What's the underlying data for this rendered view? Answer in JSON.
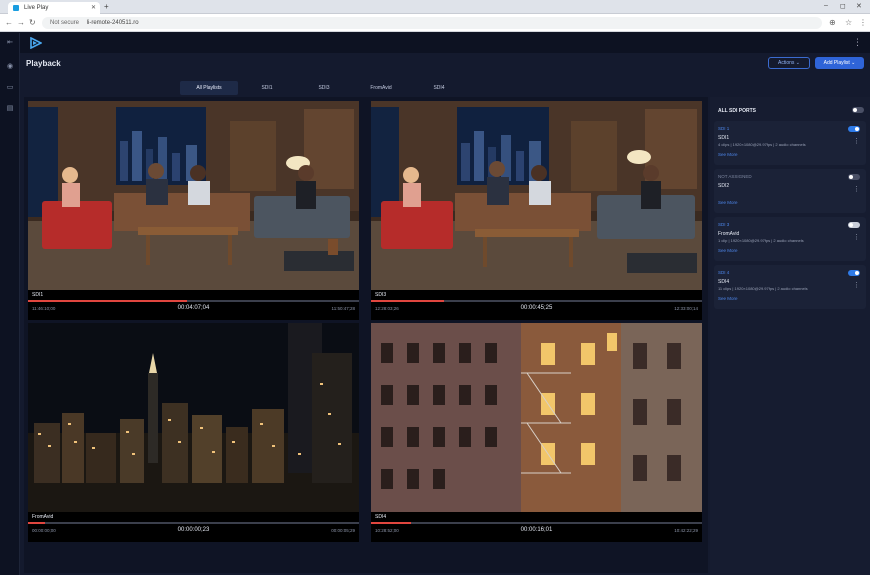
{
  "browser": {
    "tab_title": "Live Play",
    "new_tab": "+",
    "security": "Not secure",
    "url": "li-remote-240511.ro",
    "minimize": "–",
    "maximize": "◻",
    "close": "✕"
  },
  "app": {
    "page_title": "Playback",
    "actions_label": "Actions ⌄",
    "add_playlist_label": "Add Playlist ⌄",
    "tabs": [
      "All Playlists",
      "SDI1",
      "SDI3",
      "FromAvid",
      "SDI4"
    ],
    "active_tab": "All Playlists"
  },
  "tiles": [
    {
      "label": "SDI1",
      "time_left": "11:46:10;00",
      "timecode": "00:04:07;04",
      "time_right": "11:50:47;28",
      "progress": 0.48
    },
    {
      "label": "SDI3",
      "time_left": "12:28:03;26",
      "timecode": "00:00:45;25",
      "time_right": "12:33:00;14",
      "progress": 0.22
    },
    {
      "label": "FromAvid",
      "time_left": "00:00:00;00",
      "timecode": "00:00:00;23",
      "time_right": "00:00:05;29",
      "progress": 0.05
    },
    {
      "label": "SDI4",
      "time_left": "10:28:52;00",
      "timecode": "00:00:16;01",
      "time_right": "10:42:22;29",
      "progress": 0.12
    }
  ],
  "side_panel": {
    "header": "ALL SDI PORTS",
    "header_toggle": false,
    "ports": [
      {
        "port": "SDI 1",
        "name": "SDI1",
        "details": "4 clips | 1920×1080@29.97fps | 2 audio channels",
        "more": "See More",
        "enabled": true
      },
      {
        "port": "NOT ASSIGNED",
        "name": "SDI2",
        "details": "",
        "more": "See More",
        "enabled": false
      },
      {
        "port": "SDI 3",
        "name": "FromAvid",
        "details": "1 clip | 1920×1080@29.97fps | 2 audio channels",
        "more": "See More",
        "enabled": false
      },
      {
        "port": "SDI 4",
        "name": "SDI4",
        "details": "11 clips | 1920×1080@29.97fps | 2 audio channels",
        "more": "See More",
        "enabled": true
      }
    ]
  },
  "colors": {
    "accent": "#2f64d8",
    "progress": "#e0463f",
    "background": "#141a2e"
  }
}
